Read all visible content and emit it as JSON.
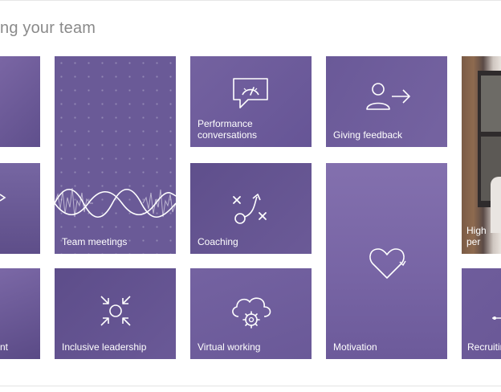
{
  "page": {
    "heading": "ng your team"
  },
  "tiles": {
    "left_top": {
      "label": ""
    },
    "left_mid": {
      "label": ""
    },
    "left_bottom": {
      "label": "nt"
    },
    "team_meetings": {
      "label": "Team meetings",
      "icon": "waveform-icon"
    },
    "performance": {
      "label": "Performance\nconversations",
      "icon": "speedometer-chat-icon"
    },
    "giving_feedback": {
      "label": "Giving feedback",
      "icon": "person-arrow-icon"
    },
    "high_performance": {
      "label": "High per",
      "icon": "photo-person"
    },
    "coaching": {
      "label": "Coaching",
      "icon": "play-strategy-icon"
    },
    "motivation": {
      "label": "Motivation",
      "icon": "heart-icon"
    },
    "inclusive_leadership": {
      "label": "Inclusive leadership",
      "icon": "converge-arrows-icon"
    },
    "virtual_working": {
      "label": "Virtual working",
      "icon": "cloud-gear-icon"
    },
    "recruiting": {
      "label": "Recruitin",
      "icon": "key-icon"
    }
  },
  "colors": {
    "tile_primary": "#6a5a97",
    "tile_dark": "#5f4f8c",
    "tile_light": "#7a67a8",
    "heading_text": "#8a8a8a"
  }
}
